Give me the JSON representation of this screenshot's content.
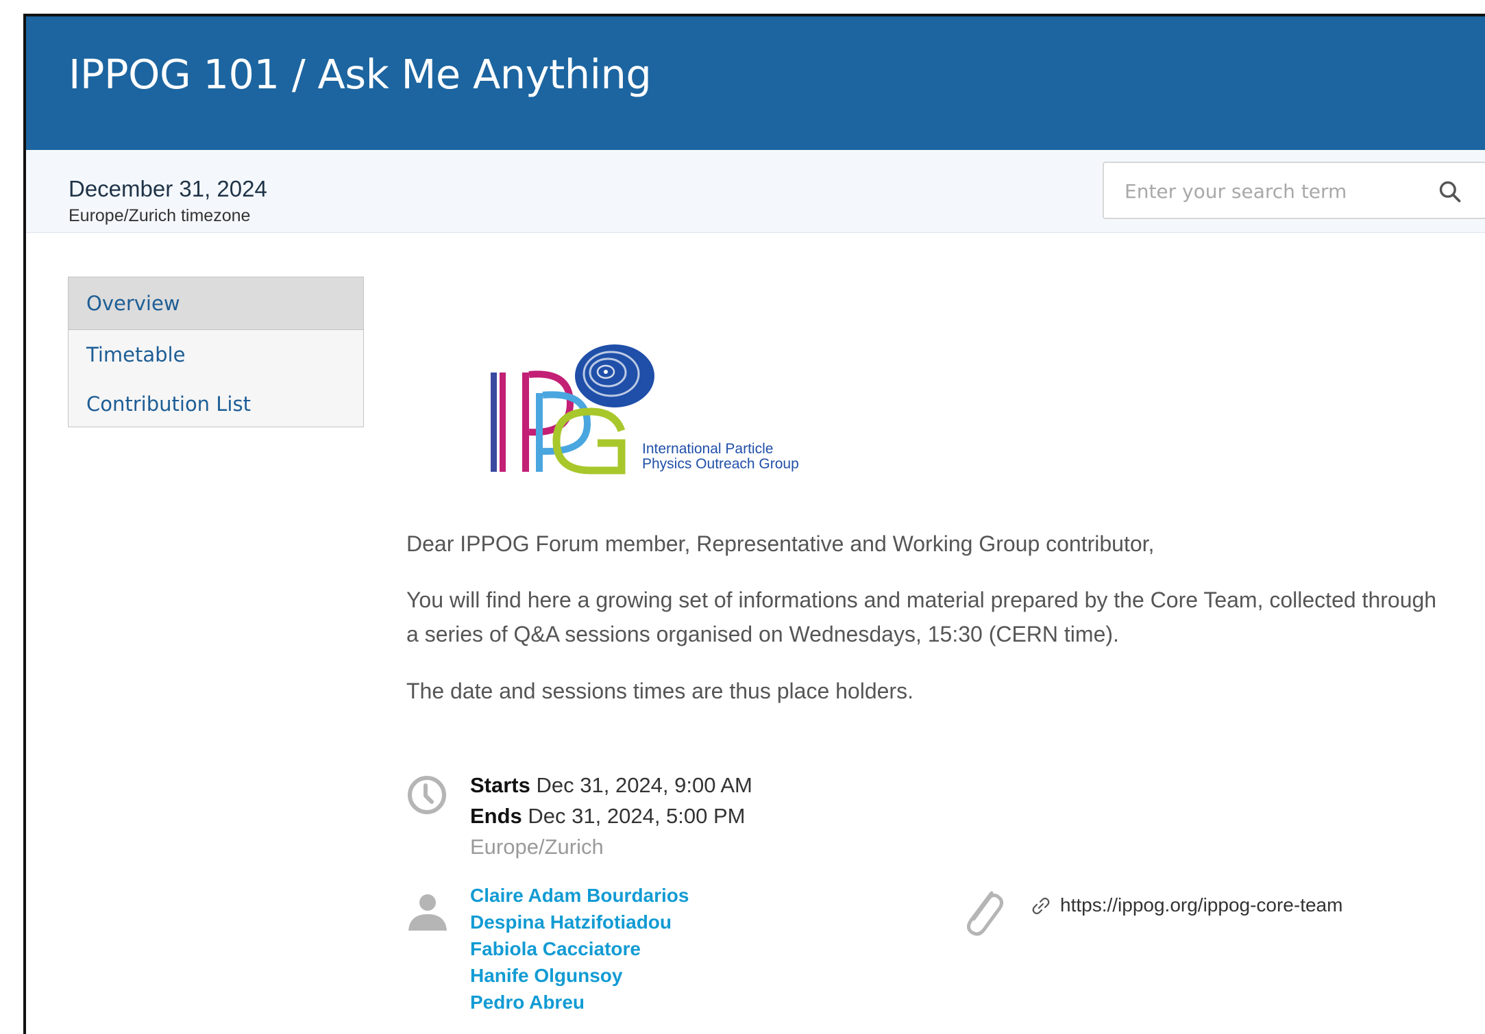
{
  "event": {
    "title": "IPPOG 101 / Ask Me Anything",
    "date": "December 31, 2024",
    "timezone_label": "Europe/Zurich timezone"
  },
  "search": {
    "placeholder": "Enter your search term"
  },
  "menu": {
    "items": [
      {
        "label": "Overview",
        "active": true
      },
      {
        "label": "Timetable",
        "active": false
      },
      {
        "label": "Contribution List",
        "active": false
      }
    ]
  },
  "logo": {
    "line1": "International Particle",
    "line2": "Physics Outreach Group",
    "colors": [
      "#c21f75",
      "#3a4aa0",
      "#4aa6df",
      "#a8c72b",
      "#1f4fa8"
    ]
  },
  "description": {
    "p1": "Dear IPPOG Forum member, Representative and Working Group contributor,",
    "p2": "You will find here a growing set of informations and material prepared by the Core Team, collected through a series of Q&A sessions organised on Wednesdays, 15:30 (CERN time).",
    "p3": "The date and sessions times are thus place holders."
  },
  "schedule": {
    "starts_label": "Starts",
    "starts_value": "Dec 31, 2024, 9:00 AM",
    "ends_label": "Ends",
    "ends_value": "Dec 31, 2024, 5:00 PM",
    "timezone": "Europe/Zurich"
  },
  "chairpersons": [
    "Claire Adam Bourdarios",
    "Despina Hatzifotiadou",
    "Fabiola Cacciatore",
    "Hanife Olgunsoy",
    "Pedro Abreu"
  ],
  "material": {
    "link": "https://ippog.org/ippog-core-team"
  },
  "icons": [
    "search-icon",
    "clock-icon",
    "person-icon",
    "paperclip-icon",
    "link-icon"
  ],
  "colors": {
    "header": "#1c65a0",
    "link": "#129bd3",
    "menu_text": "#1d5d95"
  }
}
